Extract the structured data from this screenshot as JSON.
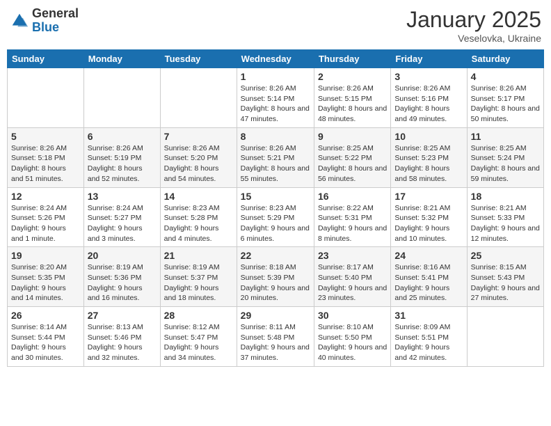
{
  "header": {
    "logo_general": "General",
    "logo_blue": "Blue",
    "month": "January 2025",
    "location": "Veselovka, Ukraine"
  },
  "days_of_week": [
    "Sunday",
    "Monday",
    "Tuesday",
    "Wednesday",
    "Thursday",
    "Friday",
    "Saturday"
  ],
  "weeks": [
    [
      {
        "day": "",
        "info": ""
      },
      {
        "day": "",
        "info": ""
      },
      {
        "day": "",
        "info": ""
      },
      {
        "day": "1",
        "info": "Sunrise: 8:26 AM\nSunset: 5:14 PM\nDaylight: 8 hours and 47 minutes."
      },
      {
        "day": "2",
        "info": "Sunrise: 8:26 AM\nSunset: 5:15 PM\nDaylight: 8 hours and 48 minutes."
      },
      {
        "day": "3",
        "info": "Sunrise: 8:26 AM\nSunset: 5:16 PM\nDaylight: 8 hours and 49 minutes."
      },
      {
        "day": "4",
        "info": "Sunrise: 8:26 AM\nSunset: 5:17 PM\nDaylight: 8 hours and 50 minutes."
      }
    ],
    [
      {
        "day": "5",
        "info": "Sunrise: 8:26 AM\nSunset: 5:18 PM\nDaylight: 8 hours and 51 minutes."
      },
      {
        "day": "6",
        "info": "Sunrise: 8:26 AM\nSunset: 5:19 PM\nDaylight: 8 hours and 52 minutes."
      },
      {
        "day": "7",
        "info": "Sunrise: 8:26 AM\nSunset: 5:20 PM\nDaylight: 8 hours and 54 minutes."
      },
      {
        "day": "8",
        "info": "Sunrise: 8:26 AM\nSunset: 5:21 PM\nDaylight: 8 hours and 55 minutes."
      },
      {
        "day": "9",
        "info": "Sunrise: 8:25 AM\nSunset: 5:22 PM\nDaylight: 8 hours and 56 minutes."
      },
      {
        "day": "10",
        "info": "Sunrise: 8:25 AM\nSunset: 5:23 PM\nDaylight: 8 hours and 58 minutes."
      },
      {
        "day": "11",
        "info": "Sunrise: 8:25 AM\nSunset: 5:24 PM\nDaylight: 8 hours and 59 minutes."
      }
    ],
    [
      {
        "day": "12",
        "info": "Sunrise: 8:24 AM\nSunset: 5:26 PM\nDaylight: 9 hours and 1 minute."
      },
      {
        "day": "13",
        "info": "Sunrise: 8:24 AM\nSunset: 5:27 PM\nDaylight: 9 hours and 3 minutes."
      },
      {
        "day": "14",
        "info": "Sunrise: 8:23 AM\nSunset: 5:28 PM\nDaylight: 9 hours and 4 minutes."
      },
      {
        "day": "15",
        "info": "Sunrise: 8:23 AM\nSunset: 5:29 PM\nDaylight: 9 hours and 6 minutes."
      },
      {
        "day": "16",
        "info": "Sunrise: 8:22 AM\nSunset: 5:31 PM\nDaylight: 9 hours and 8 minutes."
      },
      {
        "day": "17",
        "info": "Sunrise: 8:21 AM\nSunset: 5:32 PM\nDaylight: 9 hours and 10 minutes."
      },
      {
        "day": "18",
        "info": "Sunrise: 8:21 AM\nSunset: 5:33 PM\nDaylight: 9 hours and 12 minutes."
      }
    ],
    [
      {
        "day": "19",
        "info": "Sunrise: 8:20 AM\nSunset: 5:35 PM\nDaylight: 9 hours and 14 minutes."
      },
      {
        "day": "20",
        "info": "Sunrise: 8:19 AM\nSunset: 5:36 PM\nDaylight: 9 hours and 16 minutes."
      },
      {
        "day": "21",
        "info": "Sunrise: 8:19 AM\nSunset: 5:37 PM\nDaylight: 9 hours and 18 minutes."
      },
      {
        "day": "22",
        "info": "Sunrise: 8:18 AM\nSunset: 5:39 PM\nDaylight: 9 hours and 20 minutes."
      },
      {
        "day": "23",
        "info": "Sunrise: 8:17 AM\nSunset: 5:40 PM\nDaylight: 9 hours and 23 minutes."
      },
      {
        "day": "24",
        "info": "Sunrise: 8:16 AM\nSunset: 5:41 PM\nDaylight: 9 hours and 25 minutes."
      },
      {
        "day": "25",
        "info": "Sunrise: 8:15 AM\nSunset: 5:43 PM\nDaylight: 9 hours and 27 minutes."
      }
    ],
    [
      {
        "day": "26",
        "info": "Sunrise: 8:14 AM\nSunset: 5:44 PM\nDaylight: 9 hours and 30 minutes."
      },
      {
        "day": "27",
        "info": "Sunrise: 8:13 AM\nSunset: 5:46 PM\nDaylight: 9 hours and 32 minutes."
      },
      {
        "day": "28",
        "info": "Sunrise: 8:12 AM\nSunset: 5:47 PM\nDaylight: 9 hours and 34 minutes."
      },
      {
        "day": "29",
        "info": "Sunrise: 8:11 AM\nSunset: 5:48 PM\nDaylight: 9 hours and 37 minutes."
      },
      {
        "day": "30",
        "info": "Sunrise: 8:10 AM\nSunset: 5:50 PM\nDaylight: 9 hours and 40 minutes."
      },
      {
        "day": "31",
        "info": "Sunrise: 8:09 AM\nSunset: 5:51 PM\nDaylight: 9 hours and 42 minutes."
      },
      {
        "day": "",
        "info": ""
      }
    ]
  ]
}
